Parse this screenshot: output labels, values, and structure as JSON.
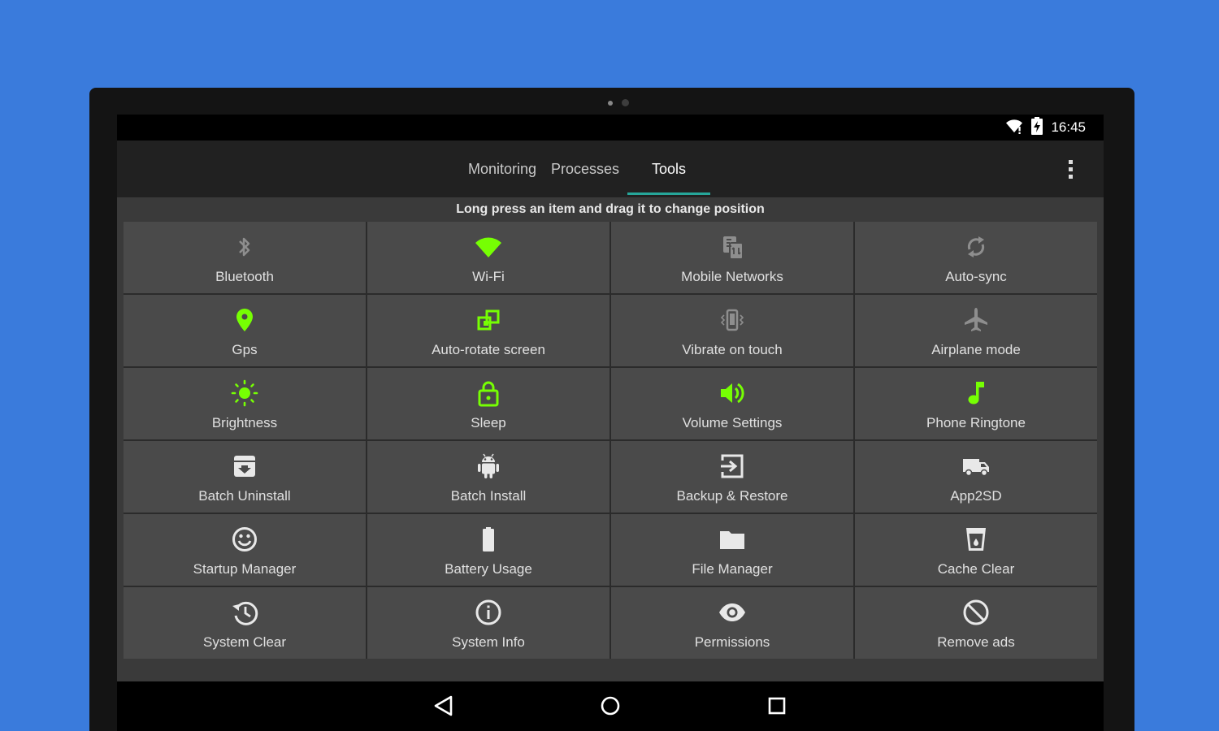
{
  "status": {
    "time": "16:45",
    "wifi_icon": "wifi-icon",
    "battery_icon": "battery-charging-icon"
  },
  "tabs": [
    {
      "label": "Monitoring"
    },
    {
      "label": "Processes"
    },
    {
      "label": "Tools",
      "active": true
    }
  ],
  "hint": "Long press an item and drag it to change position",
  "colors": {
    "accent": "#26a69a",
    "active_icon": "#76ff03",
    "inactive_icon": "#8e8e8e",
    "background": "#3a7bdc"
  },
  "tools": [
    {
      "label": "Bluetooth",
      "icon": "bluetooth-icon",
      "active": false
    },
    {
      "label": "Wi-Fi",
      "icon": "wifi-icon",
      "active": true
    },
    {
      "label": "Mobile Networks",
      "icon": "mobile-networks-icon",
      "active": false
    },
    {
      "label": "Auto-sync",
      "icon": "sync-icon",
      "active": false
    },
    {
      "label": "Gps",
      "icon": "location-pin-icon",
      "active": true
    },
    {
      "label": "Auto-rotate screen",
      "icon": "auto-rotate-icon",
      "active": true
    },
    {
      "label": "Vibrate on touch",
      "icon": "vibrate-icon",
      "active": false
    },
    {
      "label": "Airplane mode",
      "icon": "airplane-icon",
      "active": false
    },
    {
      "label": "Brightness",
      "icon": "brightness-icon",
      "active": true
    },
    {
      "label": "Sleep",
      "icon": "lock-icon",
      "active": true
    },
    {
      "label": "Volume Settings",
      "icon": "volume-icon",
      "active": true
    },
    {
      "label": "Phone Ringtone",
      "icon": "music-note-icon",
      "active": true
    },
    {
      "label": "Batch Uninstall",
      "icon": "archive-icon",
      "active": false
    },
    {
      "label": "Batch Install",
      "icon": "android-icon",
      "active": false
    },
    {
      "label": "Backup & Restore",
      "icon": "backup-icon",
      "active": false
    },
    {
      "label": "App2SD",
      "icon": "truck-icon",
      "active": false
    },
    {
      "label": "Startup Manager",
      "icon": "smiley-icon",
      "active": false
    },
    {
      "label": "Battery Usage",
      "icon": "battery-icon",
      "active": false
    },
    {
      "label": "File Manager",
      "icon": "folder-icon",
      "active": false
    },
    {
      "label": "Cache Clear",
      "icon": "cup-icon",
      "active": false
    },
    {
      "label": "System Clear",
      "icon": "history-icon",
      "active": false
    },
    {
      "label": "System Info",
      "icon": "info-icon",
      "active": false
    },
    {
      "label": "Permissions",
      "icon": "eye-icon",
      "active": false
    },
    {
      "label": "Remove ads",
      "icon": "block-icon",
      "active": false
    }
  ],
  "nav": [
    {
      "icon": "back-icon"
    },
    {
      "icon": "home-icon"
    },
    {
      "icon": "recents-icon"
    }
  ]
}
